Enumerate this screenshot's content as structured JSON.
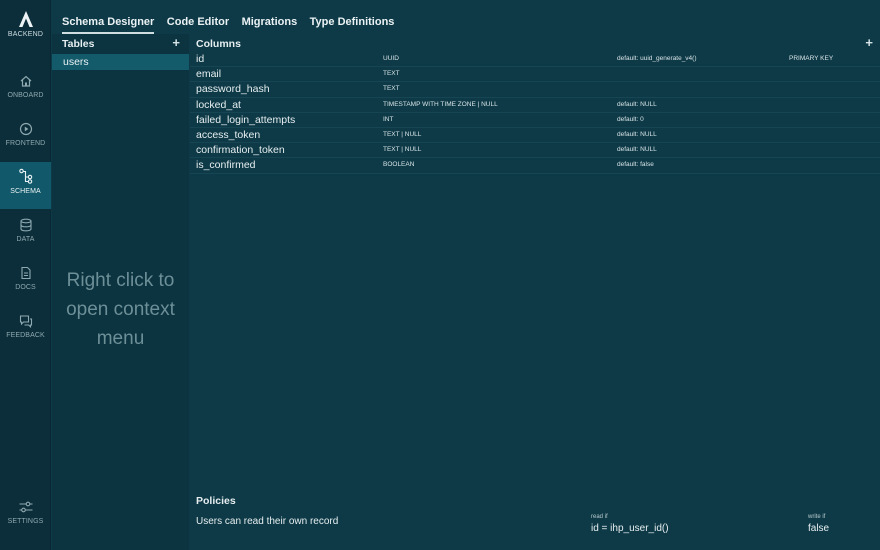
{
  "nav": {
    "logo_label": "BACKEND",
    "items": [
      {
        "label": "ONBOARD",
        "icon": "home-icon"
      },
      {
        "label": "FRONTEND",
        "icon": "play-icon"
      },
      {
        "label": "SCHEMA",
        "icon": "schema-icon"
      },
      {
        "label": "DATA",
        "icon": "database-icon"
      },
      {
        "label": "DOCS",
        "icon": "document-icon"
      },
      {
        "label": "FEEDBACK",
        "icon": "chat-icon"
      }
    ],
    "settings_label": "SETTINGS"
  },
  "tabs": [
    "Schema Designer",
    "Code Editor",
    "Migrations",
    "Type Definitions"
  ],
  "tables": {
    "header": "Tables",
    "add": "+",
    "items": [
      "users"
    ],
    "hint": "Right click to open context menu"
  },
  "columns": {
    "header": "Columns",
    "add": "+",
    "rows": [
      {
        "name": "id",
        "type": "UUID",
        "default": "default: uuid_generate_v4()",
        "key": "PRIMARY KEY"
      },
      {
        "name": "email",
        "type": "TEXT",
        "default": "",
        "key": ""
      },
      {
        "name": "password_hash",
        "type": "TEXT",
        "default": "",
        "key": ""
      },
      {
        "name": "locked_at",
        "type": "TIMESTAMP WITH TIME ZONE | NULL",
        "default": "default: NULL",
        "key": ""
      },
      {
        "name": "failed_login_attempts",
        "type": "INT",
        "default": "default: 0",
        "key": ""
      },
      {
        "name": "access_token",
        "type": "TEXT | NULL",
        "default": "default: NULL",
        "key": ""
      },
      {
        "name": "confirmation_token",
        "type": "TEXT | NULL",
        "default": "default: NULL",
        "key": ""
      },
      {
        "name": "is_confirmed",
        "type": "BOOLEAN",
        "default": "default: false",
        "key": ""
      }
    ]
  },
  "policies": {
    "header": "Policies",
    "items": [
      {
        "name": "Users can read their own record",
        "read_label": "read if",
        "read_expr": "id = ihp_user_id()",
        "write_label": "write if",
        "write_expr": "false"
      }
    ]
  },
  "colors": {
    "accent": "#135a6b",
    "background": "#0e3a47",
    "rail": "#0b2e3a"
  }
}
